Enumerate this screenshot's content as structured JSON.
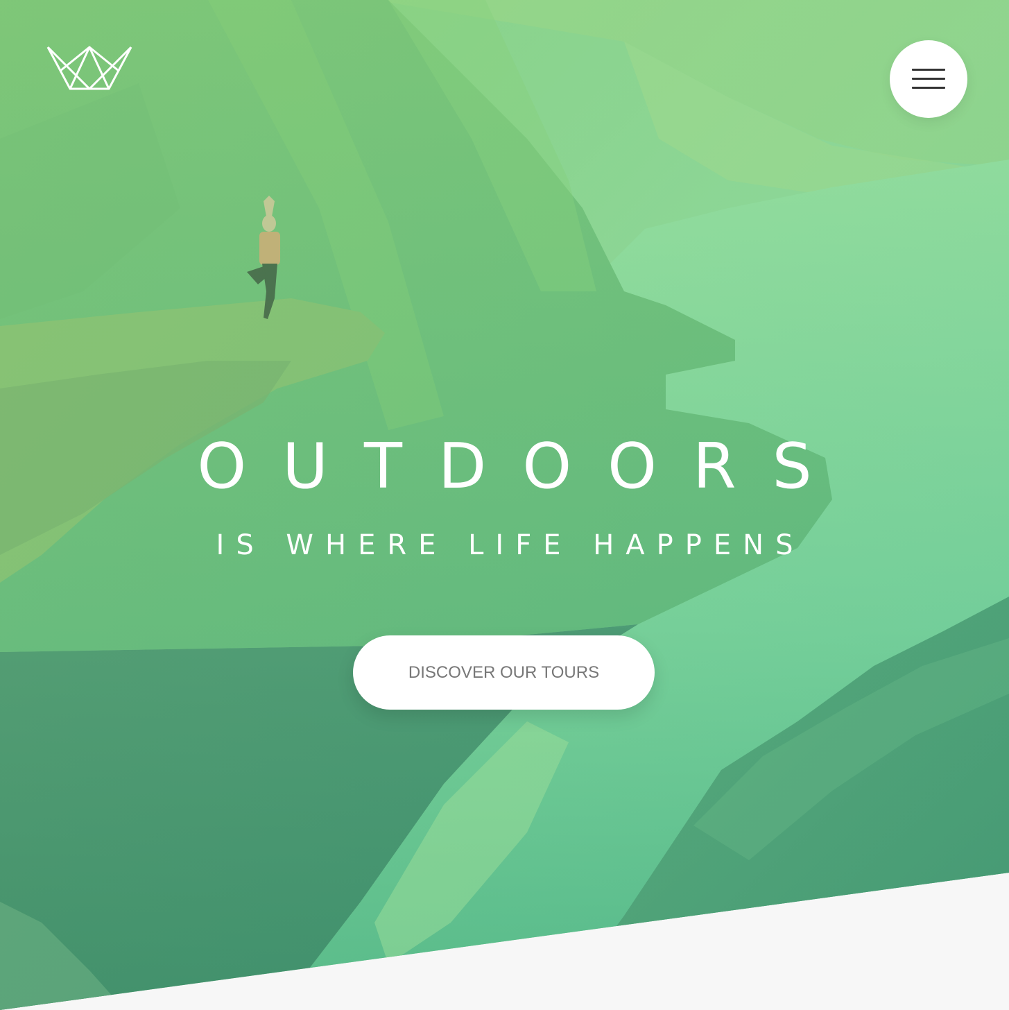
{
  "header": {
    "logo": {
      "icon": "crown-icon",
      "color": "#ffffff"
    },
    "menu_button": {
      "icon": "hamburger-menu-icon"
    }
  },
  "hero": {
    "title": "OUTDOORS",
    "subtitle": "IS WHERE LIFE HAPPENS",
    "cta_label": "DISCOVER OUR TOURS",
    "overlay_color": "#7ed56f",
    "overlay_color_dark": "#28b485",
    "background_after": "#f7f7f7"
  }
}
